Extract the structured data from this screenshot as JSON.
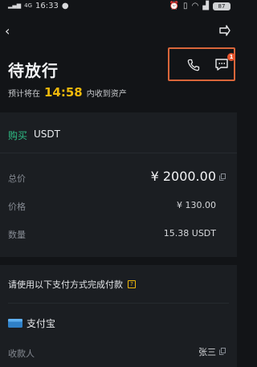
{
  "status_bar": {
    "network": "4G",
    "time": "16:33",
    "battery": "87"
  },
  "header": {
    "title": "待放行",
    "subtitle_prefix": "预计将在",
    "countdown": "14:58",
    "subtitle_suffix": "内收到资产",
    "chat_badge": "1"
  },
  "order": {
    "side": "购买",
    "asset": "USDT",
    "total_label": "总价",
    "total_value": "¥ 2000.00",
    "price_label": "价格",
    "price_value": "¥ 130.00",
    "qty_label": "数量",
    "qty_value": "15.38 USDT"
  },
  "payment": {
    "instruction": "请使用以下支付方式完成付款",
    "help_glyph": "?",
    "method": "支付宝",
    "payee_label": "收款人",
    "payee_value": "张三"
  },
  "colors": {
    "accent": "#f0b90b",
    "buy": "#2ebd85",
    "highlight_box": "#d9663a",
    "badge": "#e8542d"
  }
}
